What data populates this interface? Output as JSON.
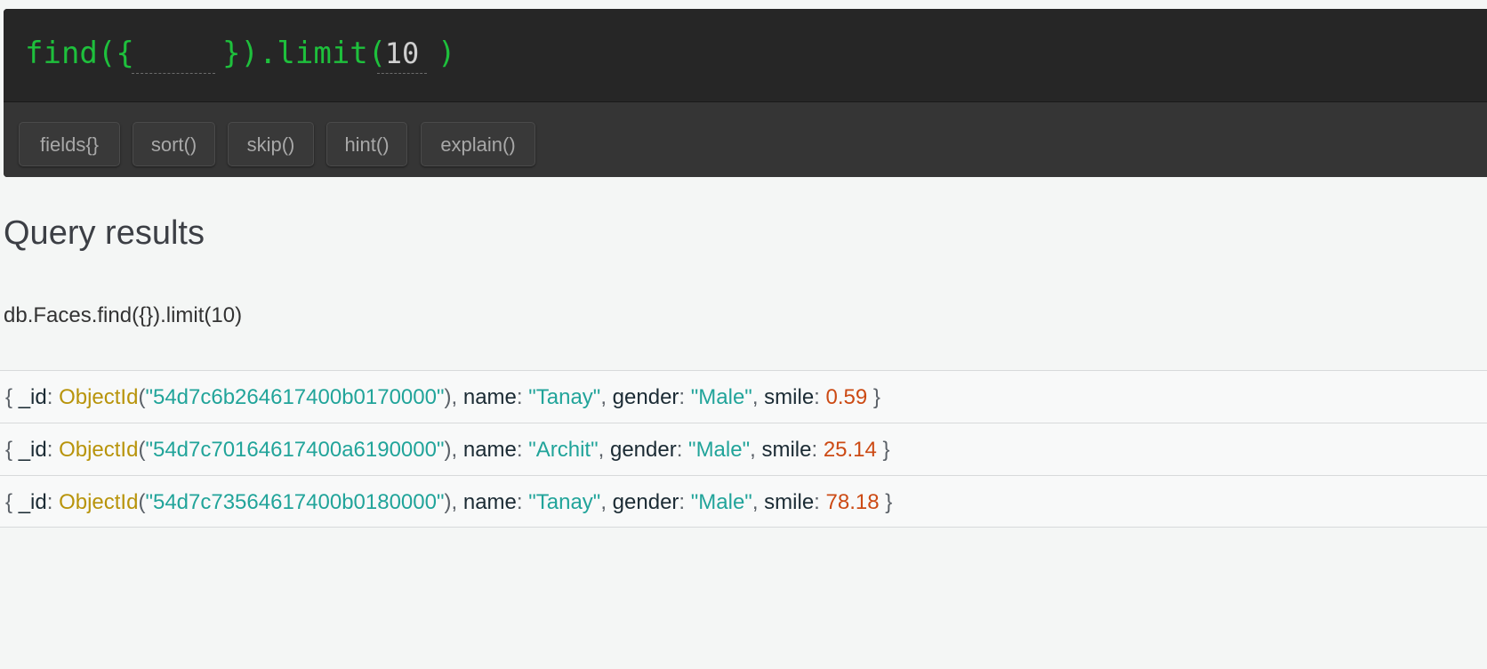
{
  "query_bar": {
    "prefix": "find({",
    "filter_value": "",
    "middle": "}).limit(",
    "limit_value": "10",
    "suffix": ")"
  },
  "toolbar": {
    "buttons": [
      "fields{}",
      "sort()",
      "skip()",
      "hint()",
      "explain()"
    ]
  },
  "results": {
    "title": "Query results",
    "query_text": "db.Faces.find({}).limit(10)",
    "rows": [
      {
        "id": "\"54d7c6b264617400b0170000\"",
        "name": "\"Tanay\"",
        "gender": "\"Male\"",
        "smile": "0.59"
      },
      {
        "id": "\"54d7c70164617400a6190000\"",
        "name": "\"Archit\"",
        "gender": "\"Male\"",
        "smile": "25.14"
      },
      {
        "id": "\"54d7c73564617400b0180000\"",
        "name": "\"Tanay\"",
        "gender": "\"Male\"",
        "smile": "78.18"
      }
    ]
  },
  "syntax": {
    "open_brace": "{",
    "close_brace": "}",
    "id_key": "_id",
    "name_key": "name",
    "gender_key": "gender",
    "smile_key": "smile",
    "objectid_fn": "ObjectId",
    "colon": ":",
    "comma": ",",
    "open_paren": "(",
    "close_paren": ")"
  },
  "colors": {
    "query_text": "#1ec03c",
    "function": "#b8940b",
    "string": "#21a49a",
    "number": "#cc4a14"
  }
}
